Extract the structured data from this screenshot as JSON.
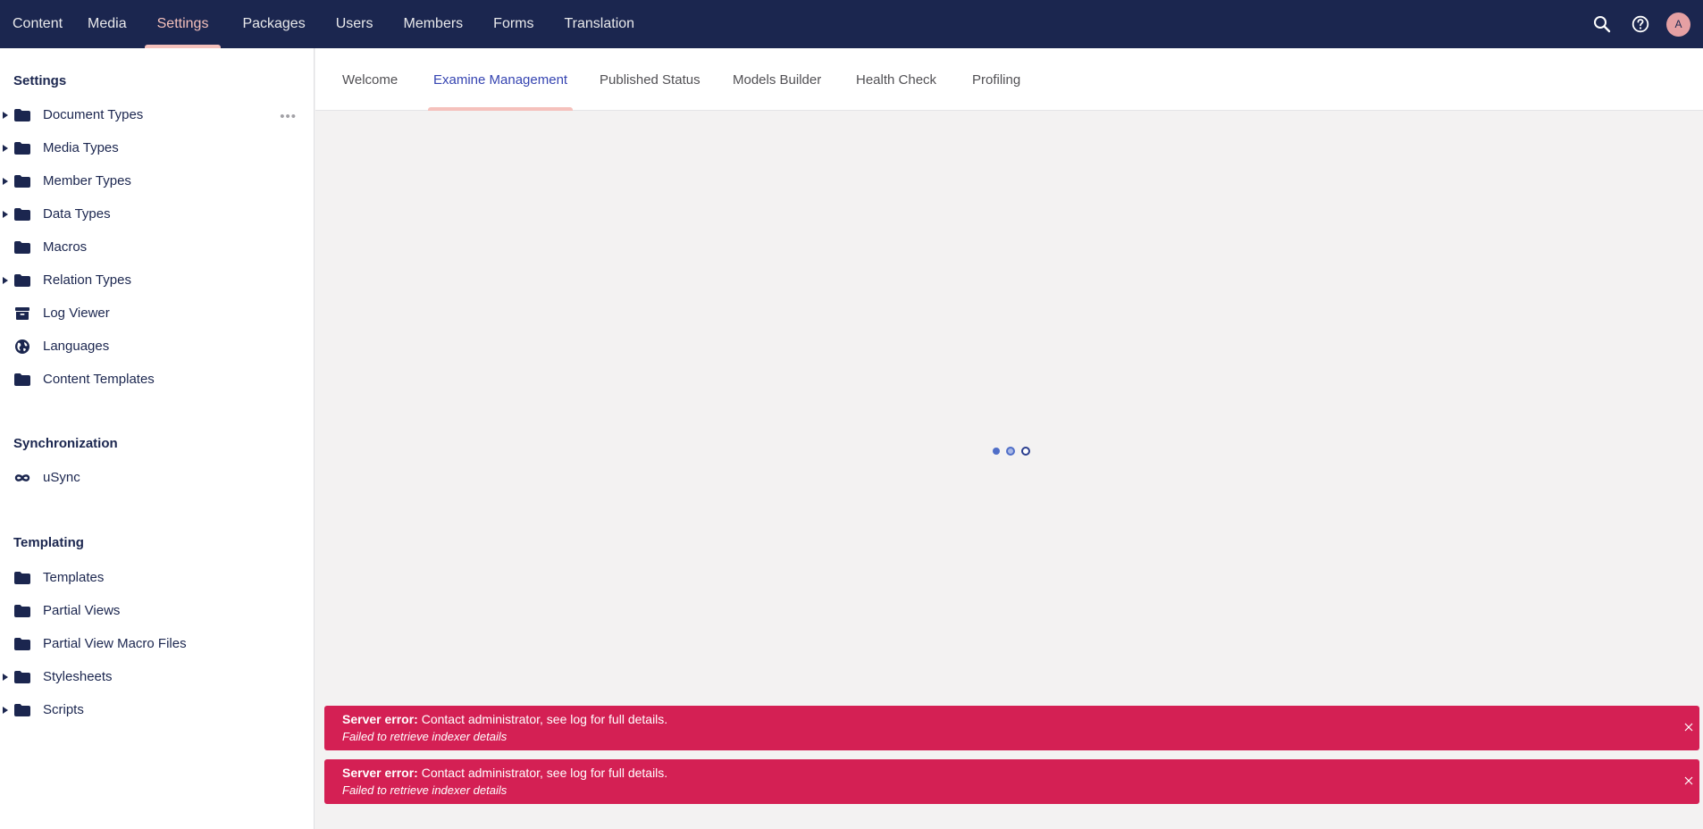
{
  "colors": {
    "header_bg": "#1b264f",
    "active_accent": "#f5c1bc",
    "active_tab_text": "#3544b1",
    "error_bg": "#d42054",
    "content_bg": "#f3f2f2"
  },
  "topnav": {
    "items": [
      {
        "label": "Content",
        "active": false
      },
      {
        "label": "Media",
        "active": false
      },
      {
        "label": "Settings",
        "active": true
      },
      {
        "label": "Packages",
        "active": false
      },
      {
        "label": "Users",
        "active": false
      },
      {
        "label": "Members",
        "active": false
      },
      {
        "label": "Forms",
        "active": false
      },
      {
        "label": "Translation",
        "active": false
      }
    ],
    "actions": {
      "search_icon": "search-icon",
      "help_icon": "help-icon",
      "avatar_initial": "A"
    }
  },
  "sidebar": {
    "sections": [
      {
        "title": "Settings",
        "items": [
          {
            "label": "Document Types",
            "icon": "folder-icon",
            "has_children": true,
            "show_more": true
          },
          {
            "label": "Media Types",
            "icon": "folder-icon",
            "has_children": true
          },
          {
            "label": "Member Types",
            "icon": "folder-icon",
            "has_children": true
          },
          {
            "label": "Data Types",
            "icon": "folder-icon",
            "has_children": true
          },
          {
            "label": "Macros",
            "icon": "folder-icon",
            "has_children": false
          },
          {
            "label": "Relation Types",
            "icon": "folder-icon",
            "has_children": true
          },
          {
            "label": "Log Viewer",
            "icon": "archive-box-icon",
            "has_children": false
          },
          {
            "label": "Languages",
            "icon": "globe-icon",
            "has_children": false
          },
          {
            "label": "Content Templates",
            "icon": "folder-icon",
            "has_children": false
          }
        ]
      },
      {
        "title": "Synchronization",
        "items": [
          {
            "label": "uSync",
            "icon": "infinity-icon",
            "has_children": false
          }
        ]
      },
      {
        "title": "Templating",
        "items": [
          {
            "label": "Templates",
            "icon": "folder-icon",
            "has_children": false
          },
          {
            "label": "Partial Views",
            "icon": "folder-icon",
            "has_children": false
          },
          {
            "label": "Partial View Macro Files",
            "icon": "folder-icon",
            "has_children": false
          },
          {
            "label": "Stylesheets",
            "icon": "folder-icon",
            "has_children": true
          },
          {
            "label": "Scripts",
            "icon": "folder-icon",
            "has_children": true
          }
        ]
      }
    ],
    "more_glyph": "•••"
  },
  "tabs": [
    {
      "label": "Welcome",
      "active": false
    },
    {
      "label": "Examine Management",
      "active": true
    },
    {
      "label": "Published Status",
      "active": false
    },
    {
      "label": "Models Builder",
      "active": false
    },
    {
      "label": "Health Check",
      "active": false
    },
    {
      "label": "Profiling",
      "active": false
    }
  ],
  "notifications": [
    {
      "title": "Server error:",
      "message": " Contact administrator, see log for full details.",
      "detail": "Failed to retrieve indexer details"
    },
    {
      "title": "Server error:",
      "message": " Contact administrator, see log for full details.",
      "detail": "Failed to retrieve indexer details"
    }
  ]
}
